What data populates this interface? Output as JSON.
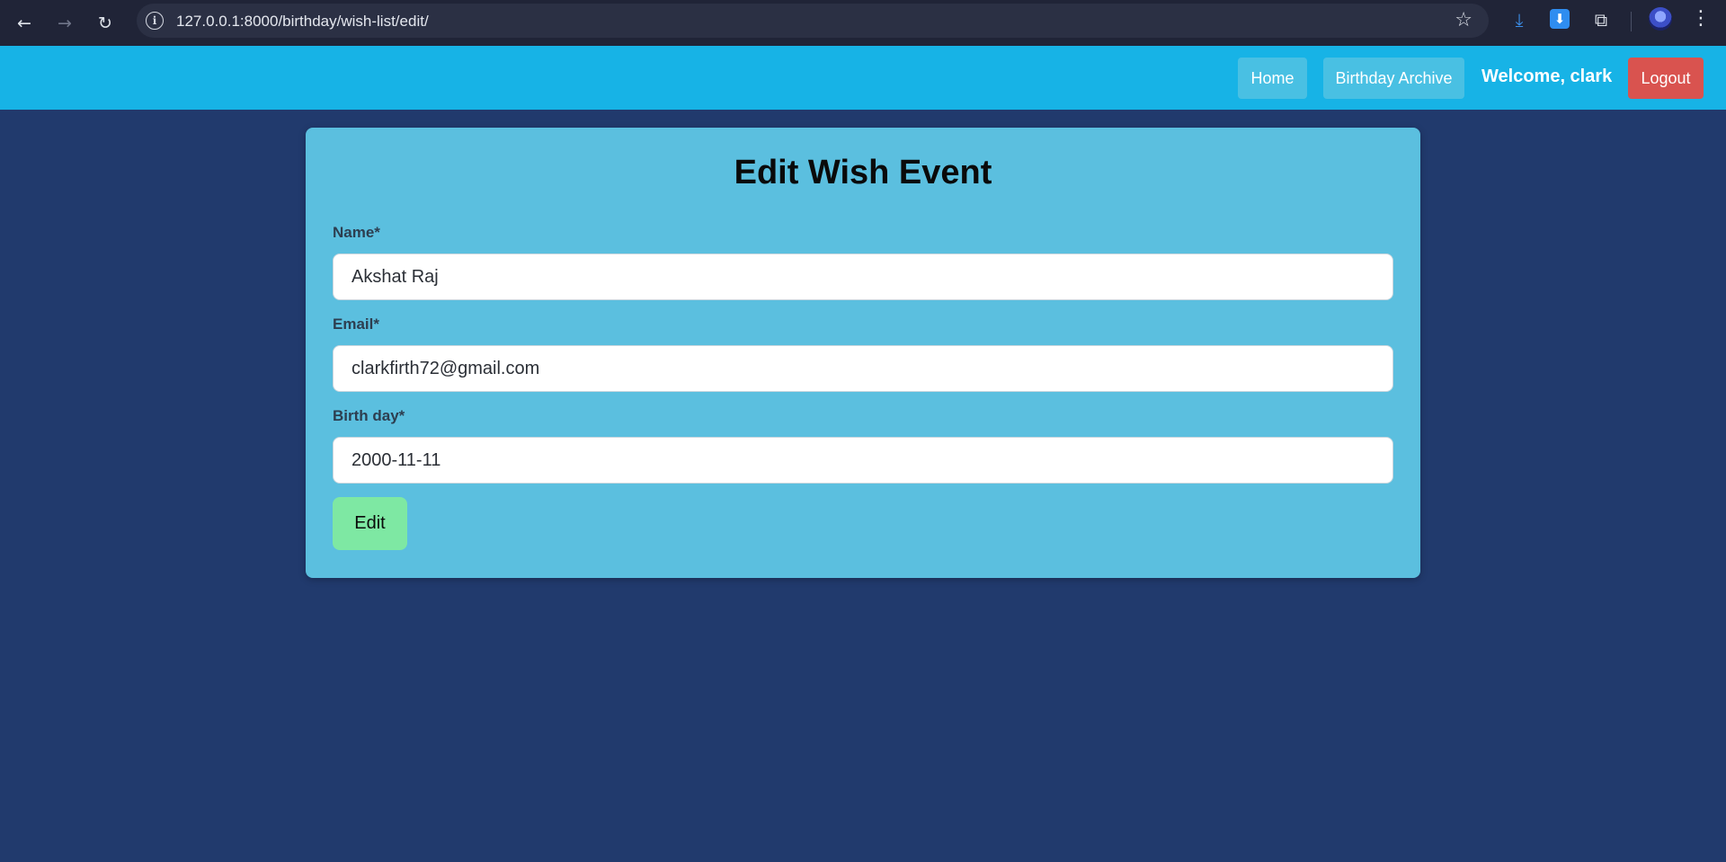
{
  "browser": {
    "url": "127.0.0.1:8000/birthday/wish-list/edit/",
    "back_icon": "←",
    "forward_icon": "→",
    "reload_icon": "↻",
    "info_icon": "i",
    "star_icon": "☆",
    "download_icon": "⤓",
    "download_box_icon": "⬇",
    "extensions_icon": "⧉",
    "menu_icon": "⋮"
  },
  "nav": {
    "home": "Home",
    "archive": "Birthday Archive",
    "welcome": "Welcome, clark",
    "logout": "Logout"
  },
  "form": {
    "title": "Edit Wish Event",
    "name_label": "Name*",
    "name_value": "Akshat Raj",
    "email_label": "Email*",
    "email_value": "clarkfirth72@gmail.com",
    "birthday_label": "Birth day*",
    "birthday_value": "2000-11-11",
    "submit_label": "Edit"
  },
  "colors": {
    "page_background": "#213a6d",
    "topbar": "#17b3e6",
    "card": "#5bbfdf",
    "logout": "#d9534f",
    "submit": "#7ee8a3"
  }
}
